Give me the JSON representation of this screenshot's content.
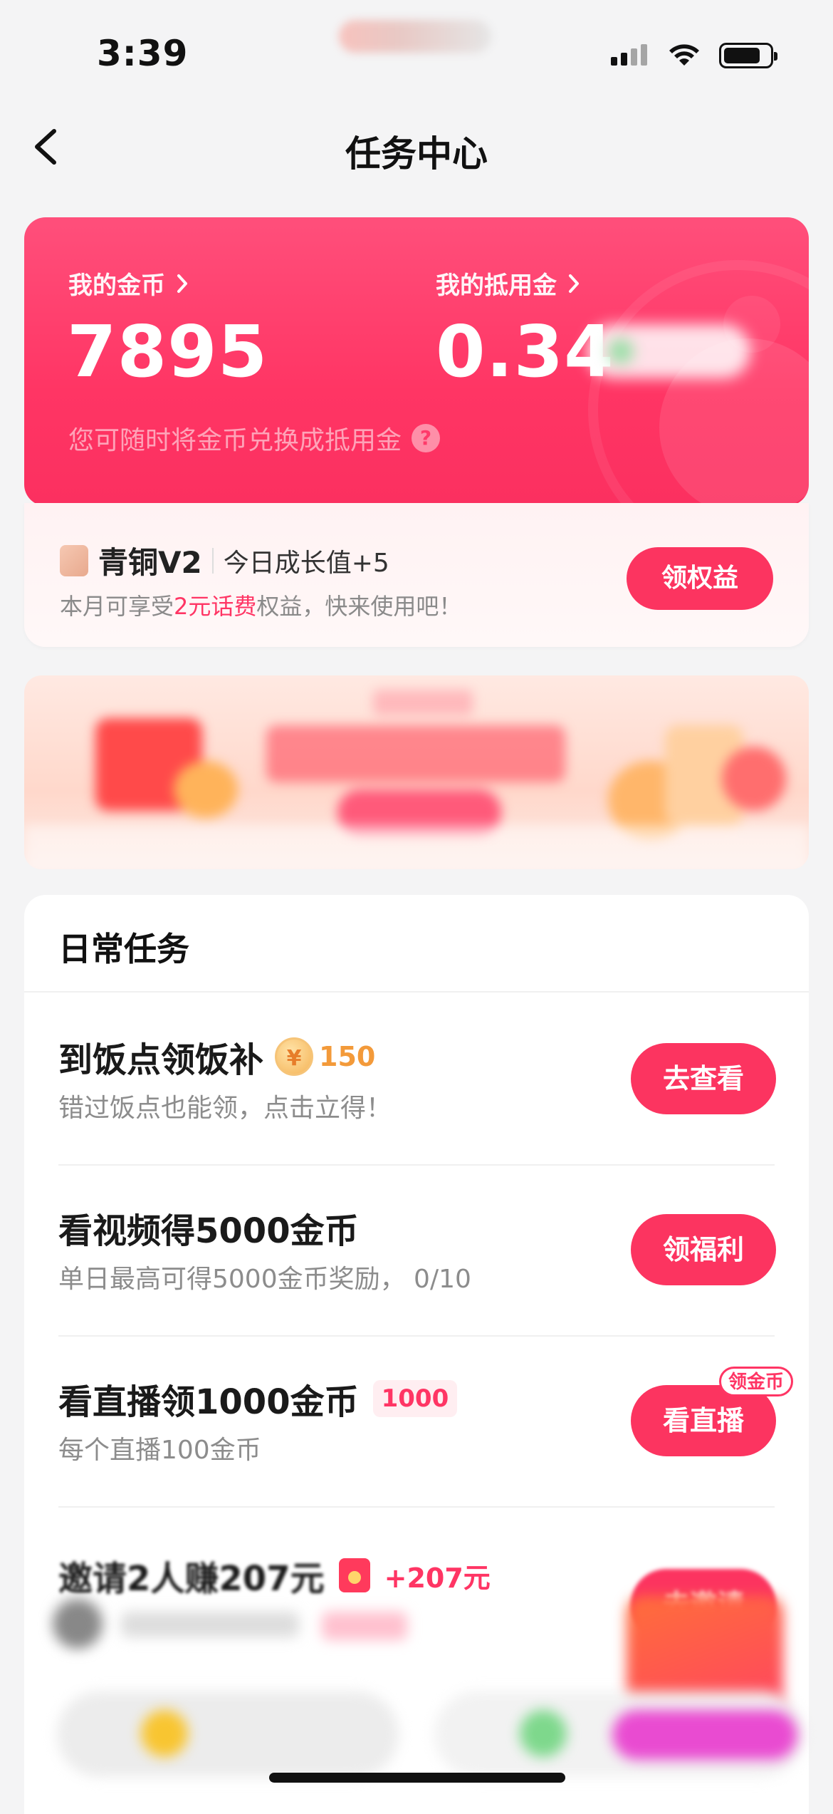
{
  "status_bar": {
    "time": "3:39"
  },
  "nav": {
    "title": "任务中心"
  },
  "wallet": {
    "coins_label": "我的金币",
    "coins_value": "7895",
    "voucher_label": "我的抵用金",
    "voucher_value": "0.34",
    "hint": "您可随时将金币兑换成抵用金",
    "hint_icon": "?"
  },
  "level": {
    "name": "青铜V2",
    "growth": "今日成长值+5",
    "desc_prefix": "本月可享受",
    "desc_highlight": "2元话费",
    "desc_suffix": "权益，快来使用吧！",
    "button": "领权益"
  },
  "daily_tasks": {
    "title": "日常任务",
    "items": [
      {
        "title": "到饭点领饭补",
        "reward": "150",
        "reward_icon": "¥",
        "subtitle": "错过饭点也能领，点击立得！",
        "button": "去查看"
      },
      {
        "title": "看视频得5000金币",
        "subtitle": "单日最高可得5000金币奖励，  0/10",
        "button": "领福利"
      },
      {
        "title": "看直播领1000金币",
        "tag": "1000",
        "subtitle": "每个直播100金币",
        "button": "看直播",
        "badge": "领金币"
      },
      {
        "title": "邀请2人赚207元",
        "reward": "+207元",
        "button": "去邀请"
      }
    ]
  },
  "colors": {
    "accent": "#fc3460",
    "coin": "#f39a3a"
  }
}
